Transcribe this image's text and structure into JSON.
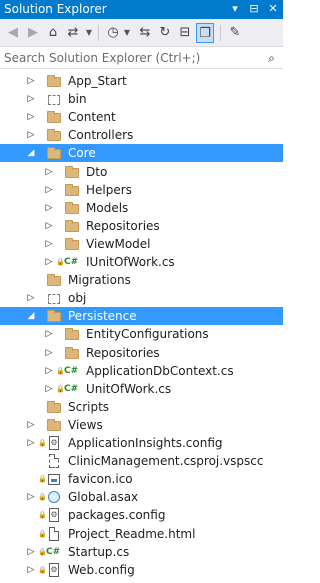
{
  "window": {
    "title": "Solution Explorer",
    "controls": [
      "▾",
      "⊟",
      "✕"
    ]
  },
  "toolbar": {
    "icons": [
      "back-icon",
      "forward-icon",
      "home-icon",
      "dropdown-arrow-icon",
      "sync-icon",
      "history-icon",
      "dropdown-arrow-icon",
      "pending-changes-icon",
      "refresh-icon",
      "collapse-all-icon",
      "show-all-files-icon",
      "properties-icon"
    ]
  },
  "search": {
    "placeholder": "Search Solution Explorer (Ctrl+;)"
  },
  "tree": [
    {
      "label": "App_Start",
      "type": "folder",
      "level": 1,
      "expand": "collapsed"
    },
    {
      "label": "bin",
      "type": "folder-dashed",
      "level": 1,
      "expand": "collapsed"
    },
    {
      "label": "Content",
      "type": "folder",
      "level": 1,
      "expand": "collapsed"
    },
    {
      "label": "Controllers",
      "type": "folder",
      "level": 1,
      "expand": "collapsed"
    },
    {
      "label": "Core",
      "type": "folder",
      "level": 1,
      "expand": "expanded",
      "selected": true
    },
    {
      "label": "Dto",
      "type": "folder",
      "level": 2,
      "expand": "collapsed"
    },
    {
      "label": "Helpers",
      "type": "folder",
      "level": 2,
      "expand": "collapsed"
    },
    {
      "label": "Models",
      "type": "folder",
      "level": 2,
      "expand": "collapsed"
    },
    {
      "label": "Repositories",
      "type": "folder",
      "level": 2,
      "expand": "collapsed"
    },
    {
      "label": "ViewModel",
      "type": "folder",
      "level": 2,
      "expand": "collapsed"
    },
    {
      "label": "IUnitOfWork.cs",
      "type": "cs",
      "level": 2,
      "expand": "collapsed",
      "locked": true
    },
    {
      "label": "Migrations",
      "type": "folder",
      "level": 1,
      "expand": "none"
    },
    {
      "label": "obj",
      "type": "folder-dashed",
      "level": 1,
      "expand": "collapsed"
    },
    {
      "label": "Persistence",
      "type": "folder",
      "level": 1,
      "expand": "expanded",
      "selected": true
    },
    {
      "label": "EntityConfigurations",
      "type": "folder",
      "level": 2,
      "expand": "collapsed"
    },
    {
      "label": "Repositories",
      "type": "folder",
      "level": 2,
      "expand": "collapsed"
    },
    {
      "label": "ApplicationDbContext.cs",
      "type": "cs",
      "level": 2,
      "expand": "collapsed",
      "locked": true
    },
    {
      "label": "UnitOfWork.cs",
      "type": "cs",
      "level": 2,
      "expand": "collapsed",
      "locked": true
    },
    {
      "label": "Scripts",
      "type": "folder",
      "level": 1,
      "expand": "none"
    },
    {
      "label": "Views",
      "type": "folder",
      "level": 1,
      "expand": "collapsed"
    },
    {
      "label": "ApplicationInsights.config",
      "type": "config",
      "level": 1,
      "expand": "collapsed",
      "locked": true
    },
    {
      "label": "ClinicManagement.csproj.vspscc",
      "type": "file-dashed",
      "level": 1,
      "expand": "none"
    },
    {
      "label": "favicon.ico",
      "type": "ico",
      "level": 1,
      "expand": "none",
      "locked": true
    },
    {
      "label": "Global.asax",
      "type": "asax",
      "level": 1,
      "expand": "collapsed",
      "locked": true
    },
    {
      "label": "packages.config",
      "type": "config",
      "level": 1,
      "expand": "none",
      "locked": true
    },
    {
      "label": "Project_Readme.html",
      "type": "file",
      "level": 1,
      "expand": "none",
      "locked": true
    },
    {
      "label": "Startup.cs",
      "type": "cs",
      "level": 1,
      "expand": "collapsed",
      "locked": true
    },
    {
      "label": "Web.config",
      "type": "config",
      "level": 1,
      "expand": "collapsed",
      "locked": true
    }
  ],
  "colors": {
    "titlebar": "#007acc",
    "selection": "#3399ff",
    "folder": "#dcb67a",
    "csharp": "#2a8a2a"
  }
}
